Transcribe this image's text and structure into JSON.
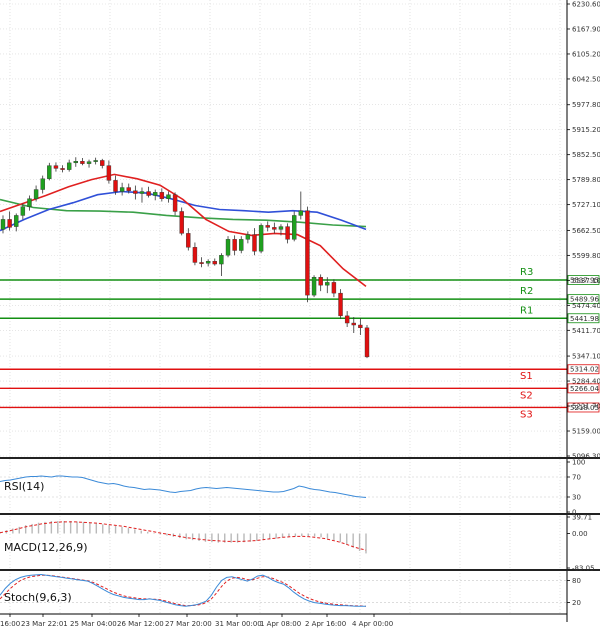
{
  "chart_data": {
    "type": "candlestick",
    "main": {
      "y_ticks": [
        "6230.60",
        "6167.90",
        "6105.20",
        "6042.50",
        "5977.80",
        "5915.20",
        "5852.50",
        "5789.80",
        "5727.10",
        "5662.50",
        "5599.80",
        "5537.10",
        "5474.40",
        "5411.70",
        "5347.10",
        "5284.40",
        "5221.70",
        "5159.00",
        "5096.30"
      ],
      "ylim": [
        5096.3,
        6230.6
      ],
      "ma_colors": {
        "red": "#e02020",
        "blue": "#3050d8",
        "green": "#3aa048"
      },
      "candles": [
        {
          "o": 5665,
          "h": 5700,
          "l": 5655,
          "c": 5690
        },
        {
          "o": 5690,
          "h": 5710,
          "l": 5662,
          "c": 5670
        },
        {
          "o": 5672,
          "h": 5705,
          "l": 5660,
          "c": 5700
        },
        {
          "o": 5700,
          "h": 5730,
          "l": 5690,
          "c": 5722
        },
        {
          "o": 5722,
          "h": 5750,
          "l": 5712,
          "c": 5742
        },
        {
          "o": 5742,
          "h": 5775,
          "l": 5735,
          "c": 5765
        },
        {
          "o": 5765,
          "h": 5800,
          "l": 5755,
          "c": 5792
        },
        {
          "o": 5792,
          "h": 5832,
          "l": 5788,
          "c": 5825
        },
        {
          "o": 5825,
          "h": 5833,
          "l": 5810,
          "c": 5818
        },
        {
          "o": 5818,
          "h": 5826,
          "l": 5808,
          "c": 5815
        },
        {
          "o": 5815,
          "h": 5840,
          "l": 5810,
          "c": 5832
        },
        {
          "o": 5832,
          "h": 5846,
          "l": 5822,
          "c": 5836
        },
        {
          "o": 5836,
          "h": 5844,
          "l": 5826,
          "c": 5830
        },
        {
          "o": 5830,
          "h": 5840,
          "l": 5820,
          "c": 5835
        },
        {
          "o": 5835,
          "h": 5845,
          "l": 5828,
          "c": 5838
        },
        {
          "o": 5838,
          "h": 5842,
          "l": 5818,
          "c": 5825
        },
        {
          "o": 5825,
          "h": 5838,
          "l": 5780,
          "c": 5788
        },
        {
          "o": 5788,
          "h": 5800,
          "l": 5752,
          "c": 5760
        },
        {
          "o": 5760,
          "h": 5782,
          "l": 5750,
          "c": 5770
        },
        {
          "o": 5770,
          "h": 5780,
          "l": 5755,
          "c": 5762
        },
        {
          "o": 5762,
          "h": 5775,
          "l": 5740,
          "c": 5755
        },
        {
          "o": 5755,
          "h": 5770,
          "l": 5732,
          "c": 5760
        },
        {
          "o": 5760,
          "h": 5772,
          "l": 5745,
          "c": 5750
        },
        {
          "o": 5750,
          "h": 5765,
          "l": 5738,
          "c": 5758
        },
        {
          "o": 5758,
          "h": 5768,
          "l": 5735,
          "c": 5742
        },
        {
          "o": 5742,
          "h": 5760,
          "l": 5732,
          "c": 5752
        },
        {
          "o": 5752,
          "h": 5758,
          "l": 5700,
          "c": 5710
        },
        {
          "o": 5710,
          "h": 5720,
          "l": 5650,
          "c": 5655
        },
        {
          "o": 5655,
          "h": 5668,
          "l": 5612,
          "c": 5620
        },
        {
          "o": 5620,
          "h": 5632,
          "l": 5575,
          "c": 5582
        },
        {
          "o": 5582,
          "h": 5595,
          "l": 5570,
          "c": 5580
        },
        {
          "o": 5580,
          "h": 5590,
          "l": 5572,
          "c": 5585
        },
        {
          "o": 5585,
          "h": 5592,
          "l": 5574,
          "c": 5578
        },
        {
          "o": 5578,
          "h": 5605,
          "l": 5548,
          "c": 5600
        },
        {
          "o": 5600,
          "h": 5648,
          "l": 5595,
          "c": 5640
        },
        {
          "o": 5640,
          "h": 5650,
          "l": 5600,
          "c": 5612
        },
        {
          "o": 5612,
          "h": 5648,
          "l": 5605,
          "c": 5640
        },
        {
          "o": 5640,
          "h": 5660,
          "l": 5630,
          "c": 5652
        },
        {
          "o": 5652,
          "h": 5668,
          "l": 5600,
          "c": 5610
        },
        {
          "o": 5610,
          "h": 5680,
          "l": 5605,
          "c": 5675
        },
        {
          "o": 5675,
          "h": 5685,
          "l": 5660,
          "c": 5670
        },
        {
          "o": 5670,
          "h": 5682,
          "l": 5655,
          "c": 5665
        },
        {
          "o": 5665,
          "h": 5678,
          "l": 5650,
          "c": 5672
        },
        {
          "o": 5672,
          "h": 5680,
          "l": 5630,
          "c": 5640
        },
        {
          "o": 5640,
          "h": 5710,
          "l": 5635,
          "c": 5700
        },
        {
          "o": 5700,
          "h": 5760,
          "l": 5690,
          "c": 5712
        },
        {
          "o": 5712,
          "h": 5722,
          "l": 5482,
          "c": 5500
        },
        {
          "o": 5500,
          "h": 5550,
          "l": 5495,
          "c": 5545
        },
        {
          "o": 5545,
          "h": 5552,
          "l": 5510,
          "c": 5525
        },
        {
          "o": 5525,
          "h": 5545,
          "l": 5505,
          "c": 5532
        },
        {
          "o": 5532,
          "h": 5540,
          "l": 5495,
          "c": 5505
        },
        {
          "o": 5505,
          "h": 5515,
          "l": 5440,
          "c": 5448
        },
        {
          "o": 5448,
          "h": 5460,
          "l": 5420,
          "c": 5430
        },
        {
          "o": 5430,
          "h": 5445,
          "l": 5405,
          "c": 5425
        },
        {
          "o": 5425,
          "h": 5442,
          "l": 5400,
          "c": 5418
        },
        {
          "o": 5418,
          "h": 5425,
          "l": 5342,
          "c": 5345
        }
      ],
      "ma_red": [
        [
          5693,
          5710
        ],
        [
          5706,
          5730
        ],
        [
          5722,
          5750
        ],
        [
          5742,
          5772
        ],
        [
          5762,
          5790
        ],
        [
          5790,
          5803
        ],
        [
          5812,
          5792
        ],
        [
          5826,
          5776
        ],
        [
          5838,
          5740
        ],
        [
          5848,
          5690
        ],
        [
          5858,
          5660
        ],
        [
          5866,
          5650
        ],
        [
          5872,
          5655
        ],
        [
          5884,
          5652
        ],
        [
          5895,
          5624
        ],
        [
          5903,
          5566
        ],
        [
          5906,
          5522
        ]
      ],
      "ma_blue": [
        [
          5672,
          5662
        ],
        [
          5676,
          5690
        ],
        [
          5690,
          5715
        ],
        [
          5712,
          5732
        ],
        [
          5734,
          5752
        ],
        [
          5756,
          5760
        ],
        [
          5784,
          5756
        ],
        [
          5808,
          5742
        ],
        [
          5828,
          5725
        ],
        [
          5848,
          5715
        ],
        [
          5862,
          5712
        ],
        [
          5878,
          5708
        ],
        [
          5894,
          5712
        ],
        [
          5904,
          5708
        ],
        [
          5915,
          5688
        ],
        [
          5928,
          5665
        ]
      ],
      "ma_green": [
        [
          5697,
          5740
        ],
        [
          5716,
          5720
        ],
        [
          5734,
          5712
        ],
        [
          5758,
          5711
        ],
        [
          5782,
          5708
        ],
        [
          5806,
          5700
        ],
        [
          5828,
          5694
        ],
        [
          5848,
          5690
        ],
        [
          5868,
          5688
        ],
        [
          5888,
          5683
        ],
        [
          5906,
          5676
        ],
        [
          5922,
          5672
        ]
      ]
    },
    "levels": [
      {
        "name": "R3",
        "value": 5537.95,
        "label": "5537.95",
        "color": "#138f13"
      },
      {
        "name": "R2",
        "value": 5489.96,
        "label": "5489.96",
        "color": "#138f13"
      },
      {
        "name": "R1",
        "value": 5441.98,
        "label": "5441.98",
        "color": "#138f13"
      },
      {
        "name": "S1",
        "value": 5314.02,
        "label": "5314.02",
        "color": "#e01010"
      },
      {
        "name": "S2",
        "value": 5266.04,
        "label": "5266.04",
        "color": "#e01010"
      },
      {
        "name": "S3",
        "value": 5218.05,
        "label": "5218.05",
        "color": "#e01010"
      }
    ],
    "rsi": {
      "title": "RSI(14)",
      "y_ticks": [
        "100",
        "70",
        "30",
        "0"
      ],
      "line_color": "#3b8ad8",
      "values": [
        61,
        63,
        64,
        66,
        68,
        70,
        71,
        71,
        72,
        71,
        70,
        72,
        72,
        71,
        70,
        70,
        69,
        66,
        63,
        60,
        58,
        56,
        57,
        55,
        52,
        50,
        49,
        47,
        45,
        46,
        45,
        44,
        42,
        40,
        39,
        41,
        42,
        43,
        46,
        48,
        49,
        48,
        47,
        48,
        49,
        48,
        47,
        46,
        45,
        44,
        43,
        42,
        41,
        40,
        40,
        41,
        44,
        47,
        52,
        50,
        47,
        45,
        44,
        42,
        40,
        39,
        37,
        35,
        33,
        31,
        30,
        29
      ]
    },
    "macd": {
      "title": "MACD(12,26,9)",
      "y_ticks": [
        "39.71",
        "0.00",
        "-83.05"
      ],
      "ylim": [
        -83.05,
        39.71
      ],
      "histogram": [
        4,
        8,
        12,
        16,
        20,
        23,
        26,
        28,
        30,
        30,
        30,
        30,
        29,
        28,
        26,
        24,
        22,
        20,
        18,
        16,
        13,
        10,
        7,
        4,
        1,
        -2,
        -5,
        -8,
        -11,
        -14,
        -16,
        -18,
        -20,
        -21,
        -22,
        -22,
        -22,
        -22,
        -21,
        -20,
        -18,
        -16,
        -14,
        -12,
        -10,
        -8,
        -7,
        -6,
        -6,
        -7,
        -9,
        -12,
        -16,
        -21,
        -27,
        -34,
        -42,
        -48
      ],
      "signal": [
        2,
        5,
        9,
        13,
        17,
        20,
        23,
        25,
        27,
        28,
        28,
        28,
        27,
        26,
        25,
        23,
        21,
        19,
        17,
        14,
        11,
        8,
        5,
        2,
        -1,
        -4,
        -7,
        -10,
        -12,
        -14,
        -16,
        -17,
        -18,
        -19,
        -19,
        -19,
        -18,
        -17,
        -15,
        -13,
        -11,
        -9,
        -8,
        -7,
        -7,
        -8,
        -10,
        -12,
        -16,
        -20,
        -25,
        -31,
        -36,
        -40
      ],
      "signal_color": "#e02020",
      "hist_color": "#b9b9b9"
    },
    "stoch": {
      "title": "Stoch(9,6,3)",
      "y_ticks": [
        "80",
        "20"
      ],
      "k": [
        40,
        58,
        72,
        82,
        88,
        92,
        94,
        95,
        96,
        94,
        92,
        90,
        88,
        86,
        84,
        82,
        80,
        78,
        72,
        64,
        56,
        48,
        42,
        38,
        34,
        32,
        30,
        28,
        28,
        30,
        28,
        26,
        22,
        18,
        14,
        12,
        10,
        12,
        14,
        18,
        24,
        40,
        62,
        80,
        88,
        90,
        86,
        82,
        78,
        84,
        92,
        94,
        88,
        80,
        74,
        70,
        60,
        48,
        38,
        30,
        24,
        20,
        18,
        16,
        14,
        13,
        12,
        12,
        11,
        10,
        10,
        10
      ],
      "d": [
        30,
        44,
        58,
        70,
        80,
        86,
        90,
        92,
        94,
        94,
        93,
        91,
        89,
        87,
        85,
        83,
        81,
        79,
        75,
        69,
        62,
        55,
        48,
        43,
        38,
        35,
        33,
        31,
        30,
        30,
        29,
        28,
        25,
        21,
        17,
        14,
        12,
        12,
        13,
        15,
        20,
        30,
        46,
        64,
        78,
        86,
        88,
        86,
        82,
        82,
        86,
        90,
        89,
        85,
        79,
        74,
        66,
        56,
        46,
        38,
        31,
        26,
        22,
        19,
        17,
        15,
        14,
        13,
        12,
        11,
        11,
        10
      ],
      "k_color": "#3b8ad8",
      "d_color": "#e02020"
    },
    "x_ticks": [
      "16:00",
      "23 Mar 22:01",
      "25 Mar 04:00",
      "26 Mar 12:00",
      "27 Mar 20:00",
      "31 Mar 00:00",
      "1 Apr 08:00",
      "2 Apr 16:00",
      "4 Apr 00:00"
    ],
    "candle_up_color": "#1fa01f",
    "candle_down_color": "#e01010"
  }
}
